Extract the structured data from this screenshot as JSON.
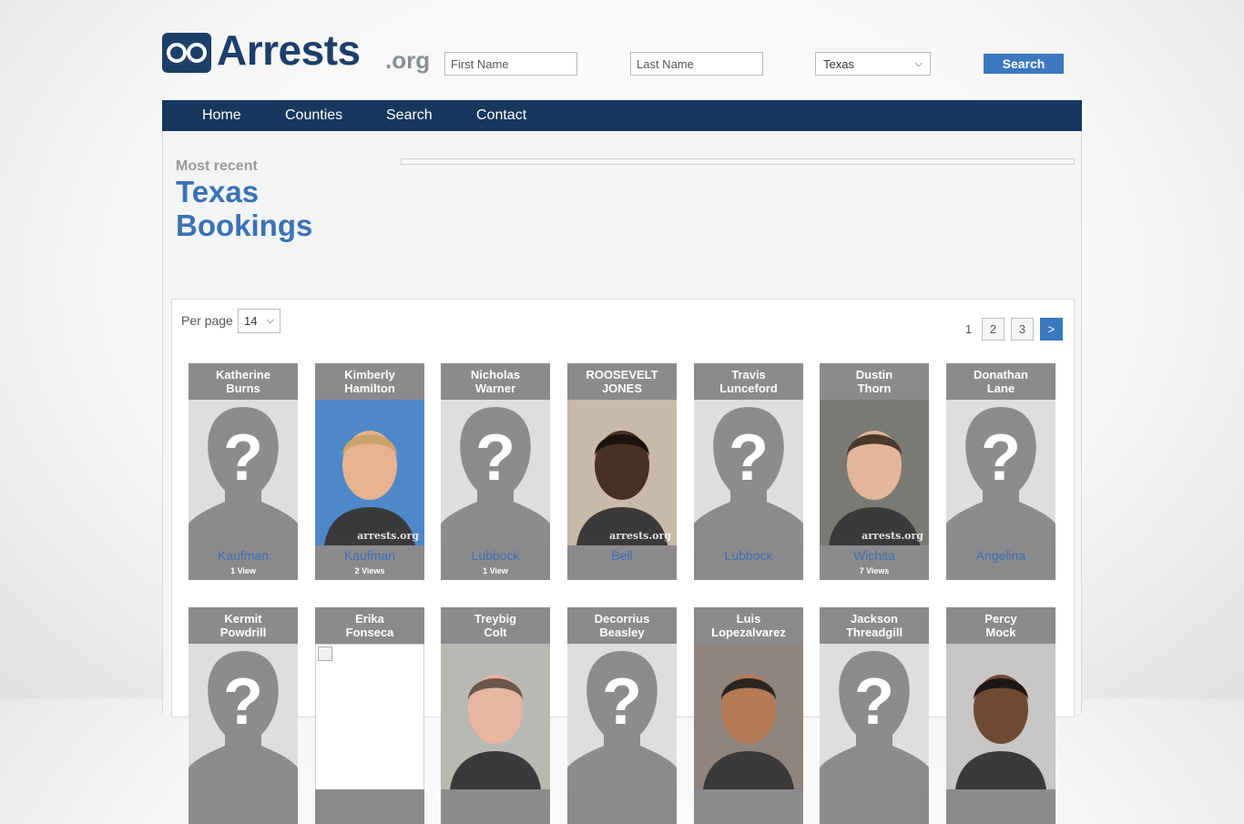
{
  "header": {
    "logo_word": "Arrests",
    "logo_org": ".org",
    "first_name_placeholder": "First Name",
    "last_name_placeholder": "Last Name",
    "state_selected": "Texas",
    "search_label": "Search"
  },
  "nav": {
    "items": [
      "Home",
      "Counties",
      "Search",
      "Contact"
    ]
  },
  "page": {
    "most_recent": "Most recent",
    "title_line1": "Texas",
    "title_line2": "Bookings"
  },
  "controls": {
    "per_page_label": "Per page",
    "per_page_value": "14",
    "pages": [
      "1",
      "2",
      "3"
    ],
    "next": ">"
  },
  "bookings": [
    {
      "first": "Katherine",
      "last": "Burns",
      "county": "Kaufman",
      "views": "1 View",
      "photo": "placeholder"
    },
    {
      "first": "Kimberly",
      "last": "Hamilton",
      "county": "Kaufman",
      "views": "2 Views",
      "photo": "mugshot",
      "watermark": "arrests.org"
    },
    {
      "first": "Nicholas",
      "last": "Warner",
      "county": "Lubbock",
      "views": "1 View",
      "photo": "placeholder"
    },
    {
      "first": "ROOSEVELT",
      "last": "JONES",
      "county": "Bell",
      "views": "",
      "photo": "mugshot",
      "watermark": "arrests.org"
    },
    {
      "first": "Travis",
      "last": "Lunceford",
      "county": "Lubbock",
      "views": "",
      "photo": "placeholder"
    },
    {
      "first": "Dustin",
      "last": "Thorn",
      "county": "Wichita",
      "views": "7 Views",
      "photo": "mugshot",
      "watermark": "arrests.org"
    },
    {
      "first": "Donathan",
      "last": "Lane",
      "county": "Angelina",
      "views": "",
      "photo": "placeholder"
    },
    {
      "first": "Kermit",
      "last": "Powdrill",
      "county": "",
      "views": "",
      "photo": "placeholder"
    },
    {
      "first": "Erika",
      "last": "Fonseca",
      "county": "",
      "views": "",
      "photo": "broken"
    },
    {
      "first": "Treybig",
      "last": "Colt",
      "county": "",
      "views": "",
      "photo": "mugshot"
    },
    {
      "first": "Decorrius",
      "last": "Beasley",
      "county": "",
      "views": "",
      "photo": "placeholder"
    },
    {
      "first": "Luis",
      "last": "Lopezalvarez",
      "county": "",
      "views": "",
      "photo": "mugshot"
    },
    {
      "first": "Jackson",
      "last": "Threadgill",
      "county": "",
      "views": "",
      "photo": "placeholder"
    },
    {
      "first": "Percy",
      "last": "Mock",
      "county": "",
      "views": "",
      "photo": "mugshot"
    }
  ]
}
